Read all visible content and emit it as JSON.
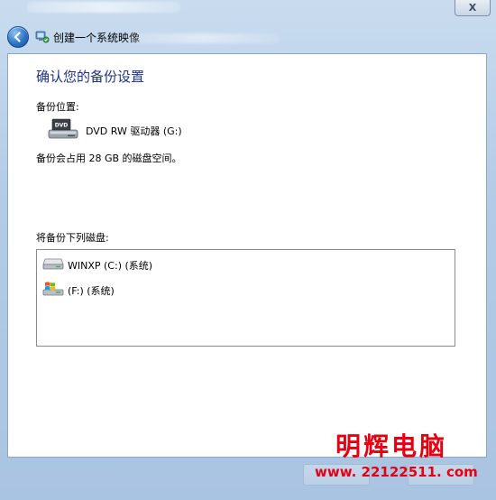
{
  "window": {
    "close_label": "X"
  },
  "header": {
    "title": "创建一个系统映像"
  },
  "main": {
    "heading": "确认您的备份设置",
    "location_label": "备份位置:",
    "location_drive": "DVD RW 驱动器 (G:)",
    "space_note": "备份会占用 28 GB 的磁盘空间。",
    "drives_label": "将备份下列磁盘:",
    "drives": [
      {
        "label": "WINXP (C:) (系统)",
        "icon": "hard-drive-icon"
      },
      {
        "label": "(F:) (系统)",
        "icon": "windows-drive-icon"
      }
    ]
  },
  "watermark": {
    "title": "明辉电脑",
    "url": "www. 22122511. com"
  },
  "colors": {
    "heading": "#1e3287",
    "watermark": "#e60012",
    "window_bg": "#b3cbe6"
  }
}
